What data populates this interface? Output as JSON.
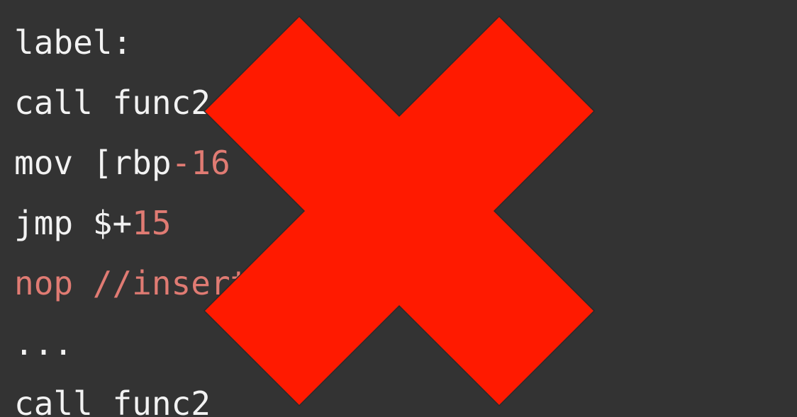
{
  "code": {
    "line1": "label:",
    "line2": "call func2",
    "line3_prefix": "mov [rbp",
    "line3_number": "-16",
    "line4_prefix": "jmp $+",
    "line4_number": "15",
    "line5": "nop //insert",
    "line6": "...",
    "line7": "call func2"
  },
  "overlay": {
    "icon": "cross-mark-icon",
    "color": "#ff1a00"
  },
  "colors": {
    "background": "#333333",
    "text": "#f2f2f2",
    "highlight": "#e07b73"
  }
}
